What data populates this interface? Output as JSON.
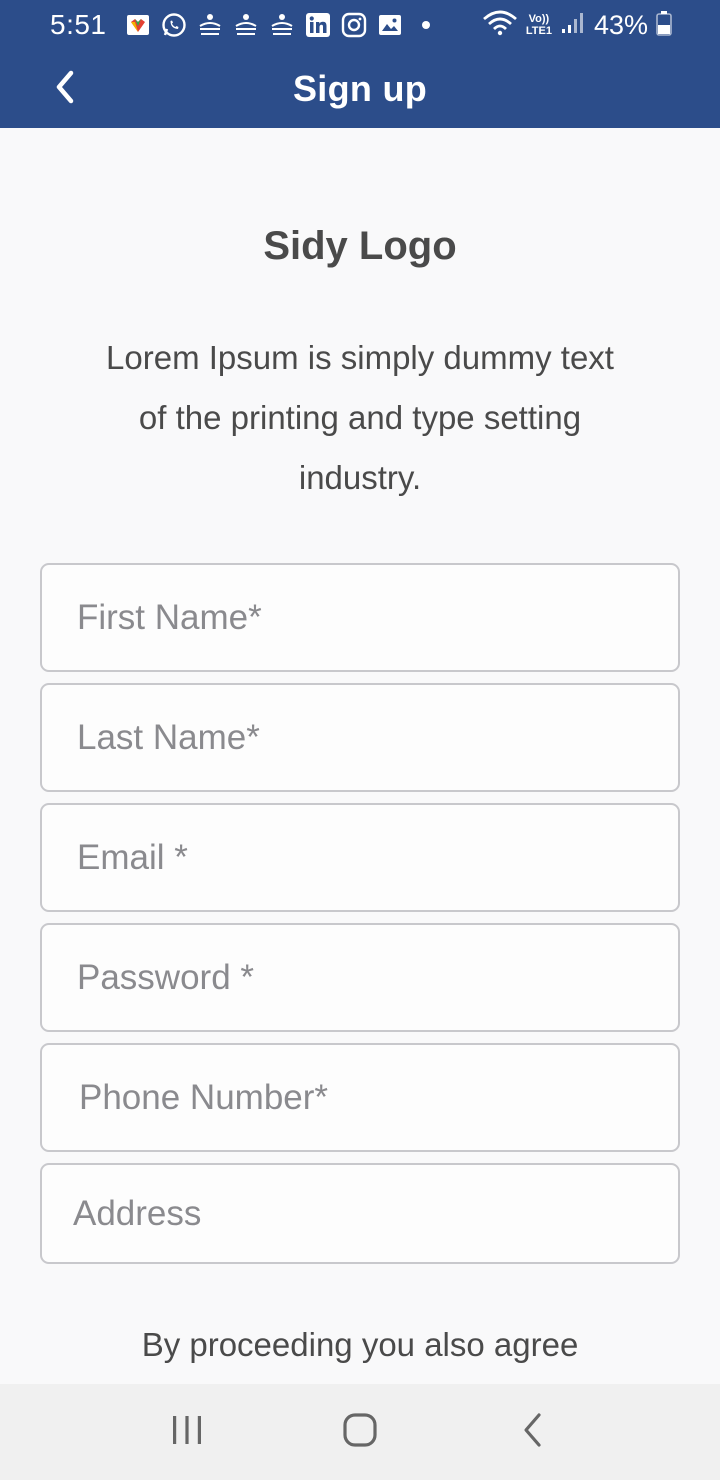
{
  "status_bar": {
    "time": "5:51",
    "notification_icons": [
      "play-games-icon",
      "whatsapp-icon",
      "divya-bhaskar-icon",
      "divya-bhaskar-icon",
      "divya-bhaskar-icon",
      "linkedin-icon",
      "instagram-icon",
      "gallery-icon",
      "dot-icon"
    ],
    "network_label": "Vo)) LTE1",
    "battery": "43%"
  },
  "app_bar": {
    "title": "Sign up",
    "back_icon": "chevron-left-icon",
    "background_color": "#2c4d8a"
  },
  "main": {
    "logo_text": "Sidy Logo",
    "description": "Lorem Ipsum is simply dummy text of the printing and type setting industry.",
    "fields": {
      "first_name": {
        "placeholder": "First Name*",
        "value": ""
      },
      "last_name": {
        "placeholder": "Last Name*",
        "value": ""
      },
      "email": {
        "placeholder": "Email *",
        "value": ""
      },
      "password": {
        "placeholder": "Password *",
        "value": ""
      },
      "phone": {
        "placeholder": "Phone Number*",
        "value": ""
      },
      "address": {
        "placeholder": "Address",
        "value": ""
      }
    },
    "terms_text": "By proceeding you also agree"
  },
  "nav_bar": {
    "buttons": [
      "recent-apps-icon",
      "home-icon",
      "back-icon"
    ]
  }
}
